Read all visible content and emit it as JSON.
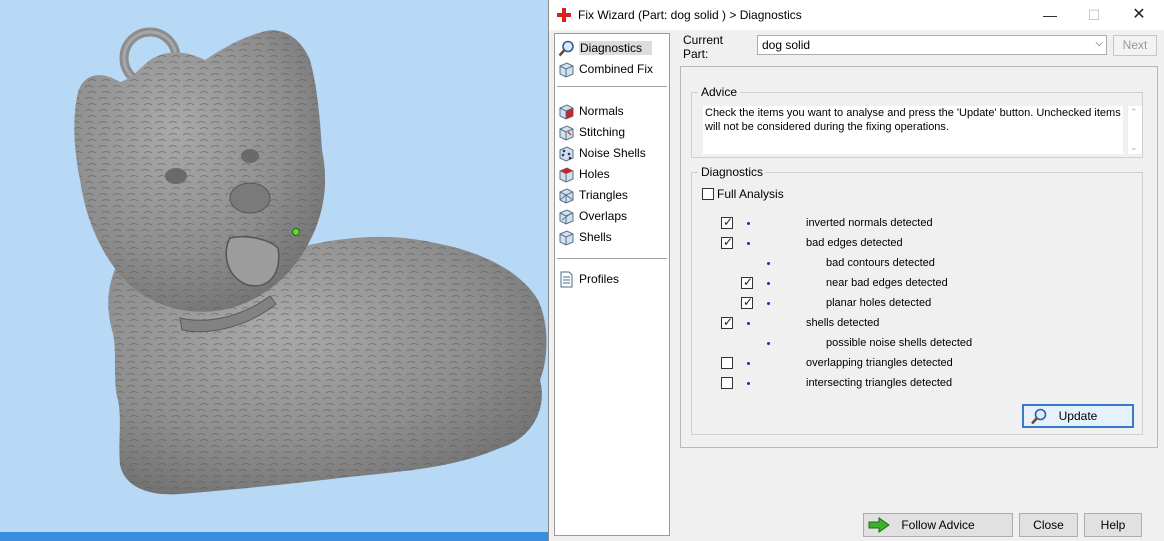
{
  "window": {
    "title": "Fix Wizard (Part: dog  solid ) > Diagnostics",
    "minimize_glyph": "—",
    "maximize_glyph": "☐",
    "close_glyph": "✕"
  },
  "nav": {
    "items": [
      {
        "label": "Diagnostics",
        "icon": "magnifier-icon",
        "selected": true
      },
      {
        "label": "Combined Fix",
        "icon": "cube-icon"
      },
      {
        "label": "Normals",
        "icon": "red-cube-icon"
      },
      {
        "label": "Stitching",
        "icon": "stitch-cube-icon"
      },
      {
        "label": "Noise Shells",
        "icon": "noise-cube-icon"
      },
      {
        "label": "Holes",
        "icon": "hole-cube-icon"
      },
      {
        "label": "Triangles",
        "icon": "triangle-cube-icon"
      },
      {
        "label": "Overlaps",
        "icon": "overlap-cube-icon"
      },
      {
        "label": "Shells",
        "icon": "shell-cube-icon"
      },
      {
        "label": "Profiles",
        "icon": "document-icon"
      }
    ]
  },
  "part": {
    "label": "Current Part:",
    "value": "dog  solid",
    "next_label": "Next"
  },
  "advice": {
    "title": "Advice",
    "text": "Check the items you want to analyse and press the 'Update' button. Unchecked items will not be considered during the fixing operations."
  },
  "diagnostics": {
    "title": "Diagnostics",
    "full_analysis_label": "Full Analysis",
    "full_analysis_checked": false,
    "items": [
      {
        "label": "inverted normals detected",
        "checked": true,
        "level": 0
      },
      {
        "label": "bad edges detected",
        "checked": true,
        "level": 0
      },
      {
        "label": "bad contours detected",
        "checked": null,
        "level": 1
      },
      {
        "label": "near bad edges detected",
        "checked": true,
        "level": 1
      },
      {
        "label": "planar holes detected",
        "checked": true,
        "level": 1
      },
      {
        "label": "shells detected",
        "checked": true,
        "level": 0
      },
      {
        "label": "possible noise shells detected",
        "checked": null,
        "level": 1
      },
      {
        "label": "overlapping triangles detected",
        "checked": false,
        "level": 0
      },
      {
        "label": "intersecting triangles detected",
        "checked": false,
        "level": 0
      }
    ],
    "check_glyph": "✓"
  },
  "buttons": {
    "update": "Update",
    "follow_advice": "Follow Advice",
    "close": "Close",
    "help": "Help"
  },
  "colors": {
    "viewport_bg": "#b7d9f6",
    "model_gray": "#8f8f8f",
    "accent_blue": "#3a78c8",
    "app_icon_red": "#d9201c",
    "follow_arrow_green": "#3cb02c"
  }
}
